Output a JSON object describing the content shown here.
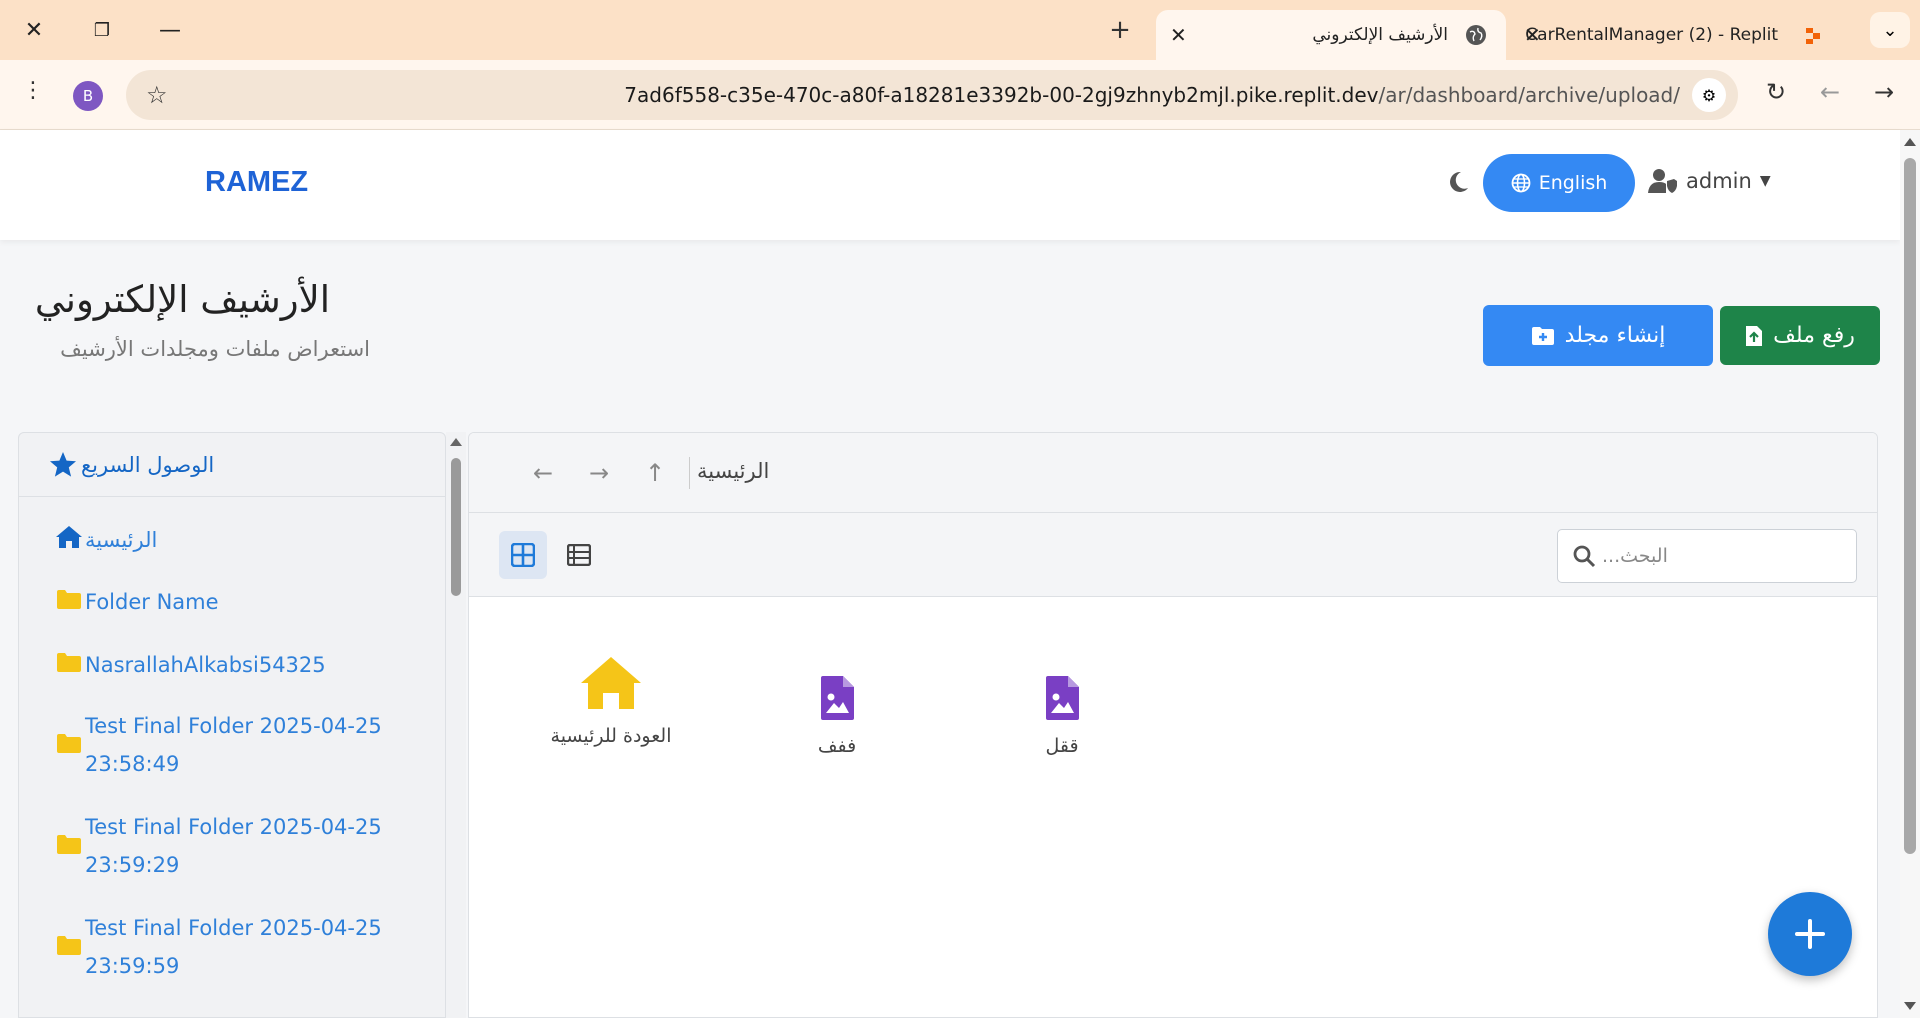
{
  "browser": {
    "window_controls": {
      "close": "✕",
      "restore": "❐",
      "minimize": "—"
    },
    "new_tab": "+",
    "tabs": [
      {
        "title": "الأرشيف الإلكتروني",
        "active": true,
        "close": "✕"
      },
      {
        "title": "CarRentalManager (2) - Replit",
        "active": false,
        "close": "✕"
      }
    ],
    "tab_menu": "⌄",
    "profile_initial": "B",
    "url_host": "7ad6f558-c35e-470c-a80f-a18281e3392b-00-2gj9zhnyb2mjl.pike.replit.dev",
    "url_path": "/ar/dashboard/archive/upload/",
    "nav": {
      "reload": "↻",
      "back": "←",
      "forward": "→"
    }
  },
  "app": {
    "brand": "RAMEZ",
    "language_button": "English",
    "user_name": "admin",
    "accent_color": "#3489f3",
    "success_color": "#1e8449"
  },
  "page": {
    "title": "الأرشيف الإلكتروني",
    "subtitle": "استعراض ملفات ومجلدات الأرشيف",
    "create_folder_label": "إنشاء مجلد",
    "upload_file_label": "رفع ملف"
  },
  "sidebar": {
    "heading": "الوصول السريع",
    "items": [
      {
        "label": "الرئيسية",
        "icon": "home-icon"
      },
      {
        "label": "Folder Name",
        "icon": "folder-icon"
      },
      {
        "label": "NasrallahAlkabsi54325",
        "icon": "folder-icon"
      },
      {
        "label": "Test Final Folder 2025-04-25 23:58:49",
        "icon": "folder-icon"
      },
      {
        "label": "Test Final Folder 2025-04-25 23:59:29",
        "icon": "folder-icon"
      },
      {
        "label": "Test Final Folder 2025-04-25 23:59:59",
        "icon": "folder-icon"
      }
    ]
  },
  "file_browser": {
    "nav": {
      "back": "←",
      "forward": "→",
      "up": "↑"
    },
    "breadcrumb": "الرئيسية",
    "search_placeholder": "البحث...",
    "items": [
      {
        "label": "العودة للرئيسية",
        "icon": "home-icon"
      },
      {
        "label": "ففف",
        "icon": "image-file-icon"
      },
      {
        "label": "ققل",
        "icon": "image-file-icon"
      }
    ]
  }
}
